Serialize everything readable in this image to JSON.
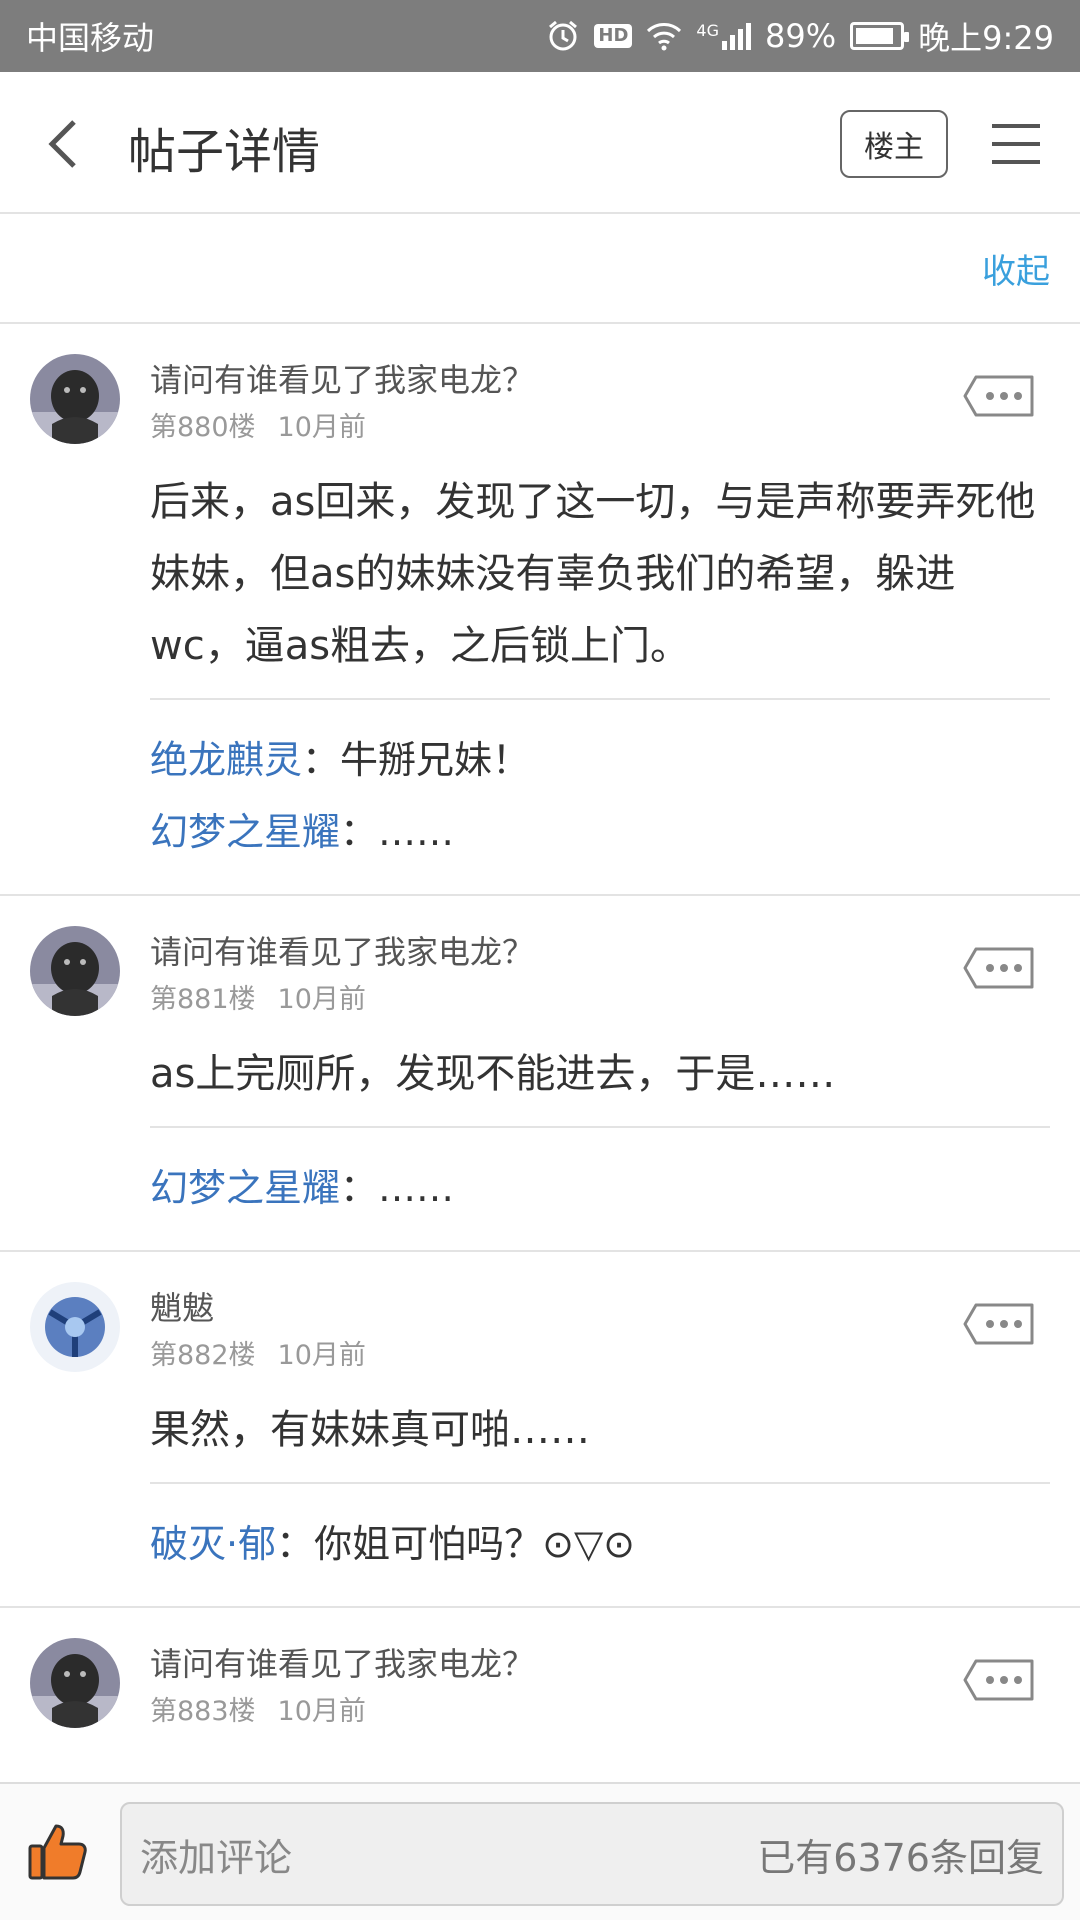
{
  "status": {
    "carrier": "中国移动",
    "network": "4G",
    "battery": "89%",
    "battery_level": 0.89,
    "time": "晚上9:29"
  },
  "header": {
    "title": "帖子详情",
    "owner_button": "楼主"
  },
  "collapse": {
    "label": "收起"
  },
  "floors": [
    {
      "user": "请问有谁看见了我家电龙？",
      "floor": "第880楼",
      "time": "10月前",
      "text": "后来，as回来，发现了这一切，与是声称要弄死他妹妹，但as的妹妹没有辜负我们的希望，躲进wc，逼as粗去，之后锁上门。",
      "replies": [
        {
          "who": "绝龙麒灵",
          "sep": "：",
          "text": "牛掰兄妹！"
        },
        {
          "who": "幻梦之星耀",
          "sep": "：",
          "text": "……"
        }
      ]
    },
    {
      "user": "请问有谁看见了我家电龙？",
      "floor": "第881楼",
      "time": "10月前",
      "text": "as上完厕所，发现不能进去，于是……",
      "replies": [
        {
          "who": "幻梦之星耀",
          "sep": "：",
          "text": "……"
        }
      ]
    },
    {
      "user": "魈魃",
      "floor": "第882楼",
      "time": "10月前",
      "text": "果然，有妹妹真可啪……",
      "replies": [
        {
          "who": "破灭·郁",
          "sep": "：",
          "text": "你姐可怕吗？⊙▽⊙"
        }
      ]
    },
    {
      "user": "请问有谁看见了我家电龙？",
      "floor": "第883楼",
      "time": "10月前"
    }
  ],
  "bottom": {
    "placeholder": "添加评论",
    "reply_count": "已有6376条回复"
  }
}
